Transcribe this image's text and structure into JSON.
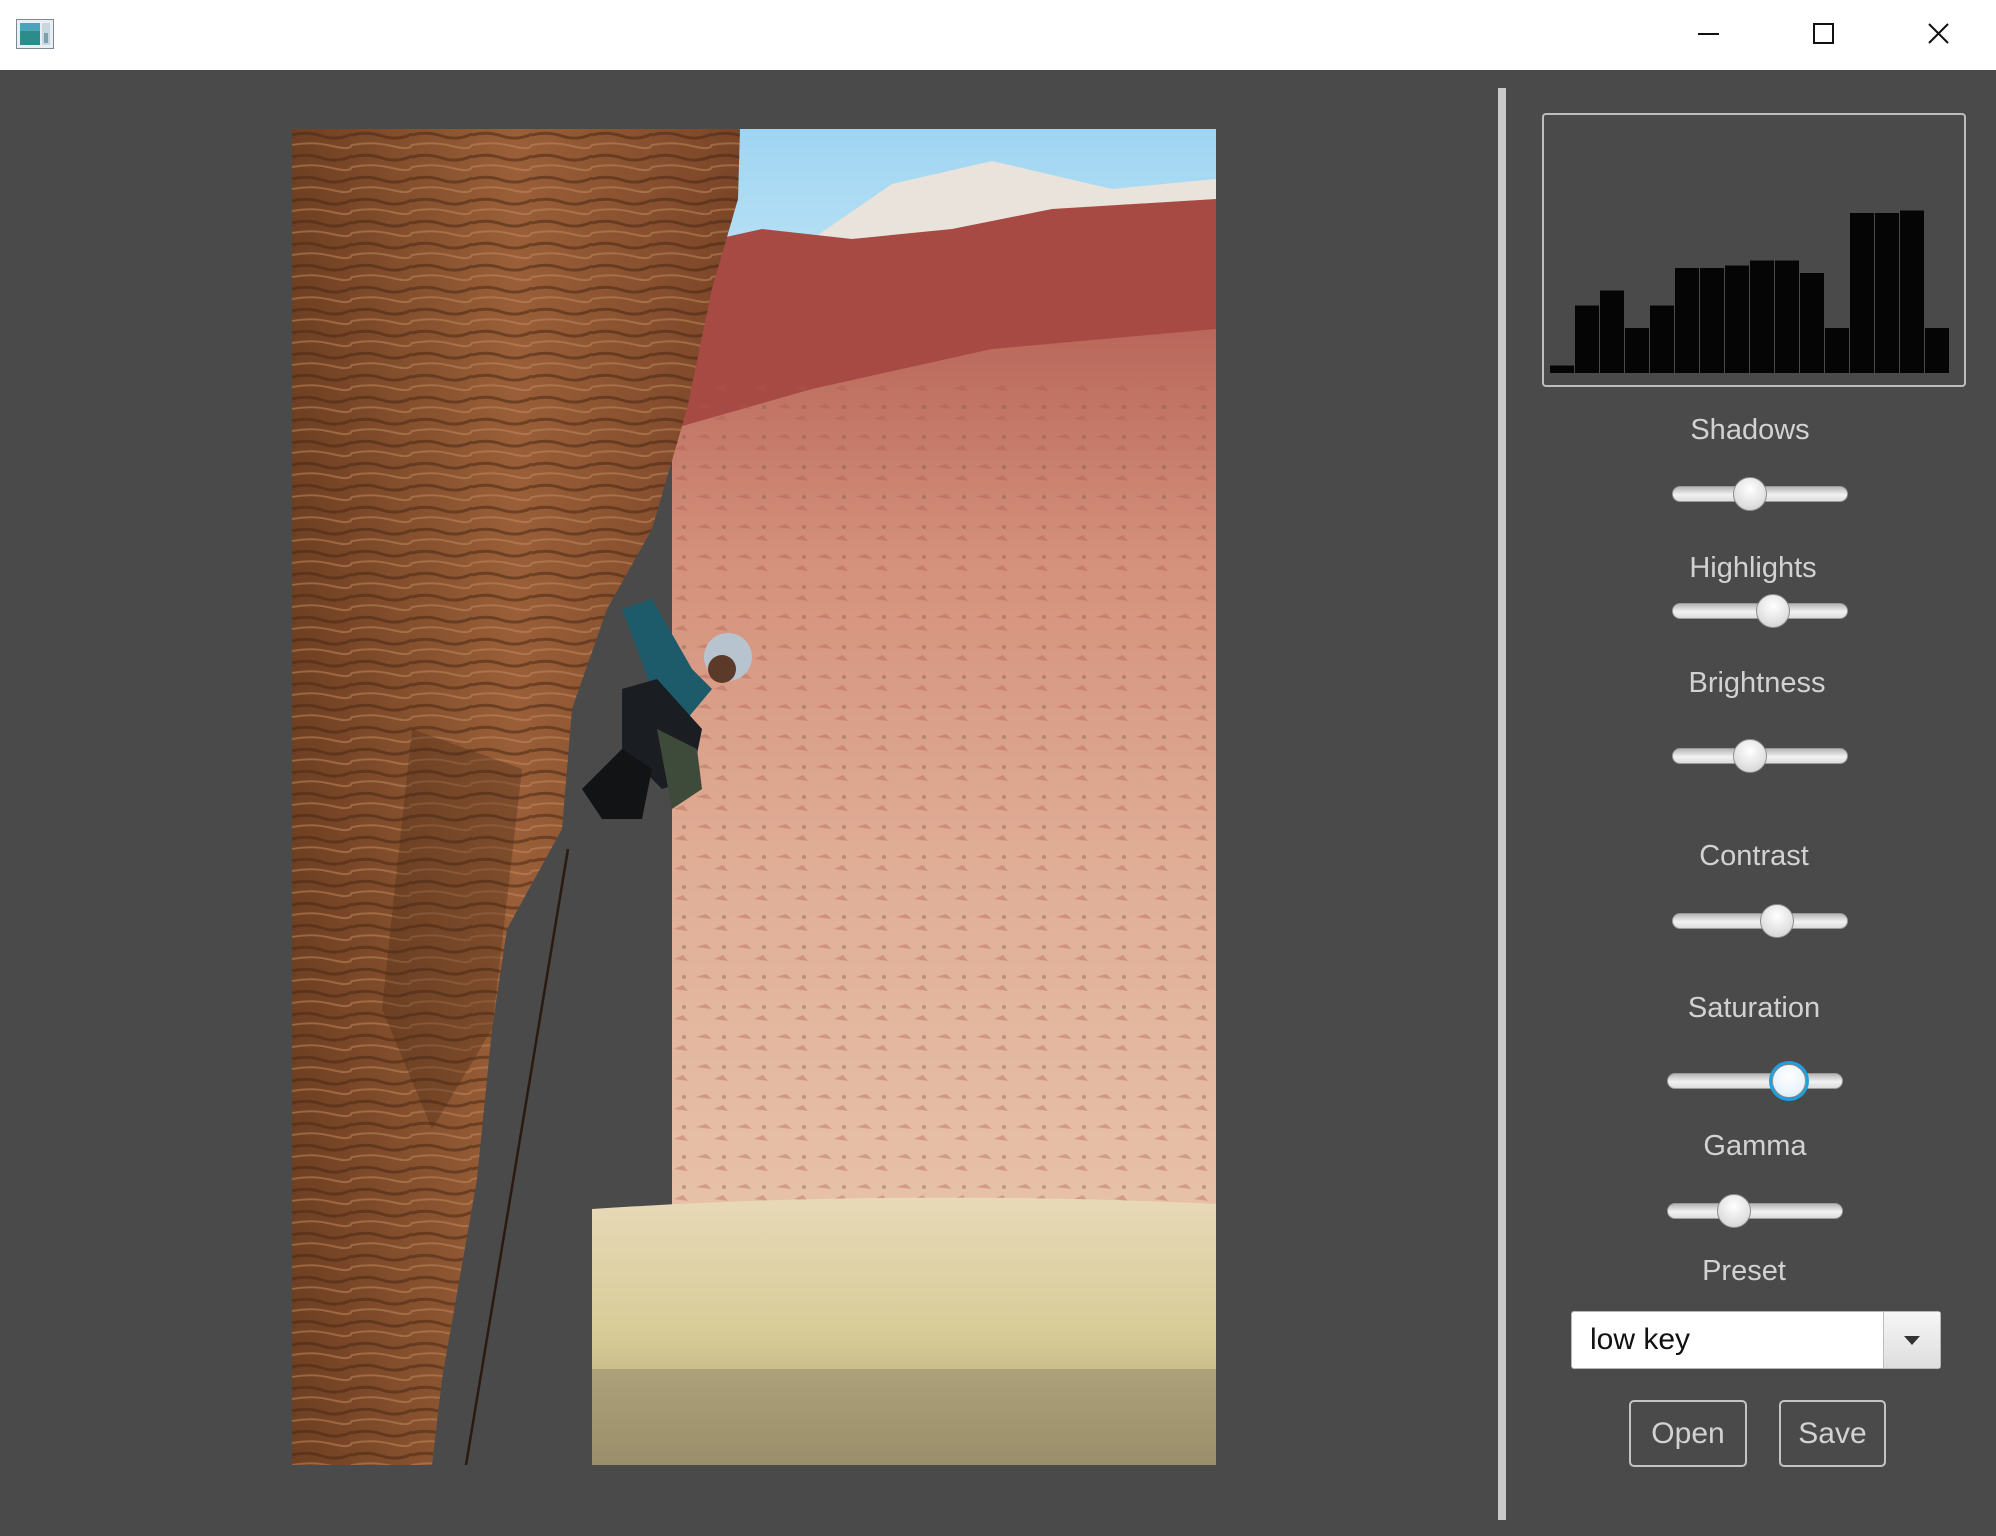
{
  "window": {
    "icon": "app-image-icon",
    "controls": [
      "minimize-icon",
      "maximize-icon",
      "close-icon"
    ]
  },
  "image": {
    "description_icon": "photo-rock-climber"
  },
  "histogram": {
    "bins": [
      0.03,
      0.27,
      0.33,
      0.18,
      0.27,
      0.42,
      0.42,
      0.43,
      0.45,
      0.45,
      0.4,
      0.18,
      0.64,
      0.64,
      0.65,
      0.18
    ]
  },
  "controls": {
    "shadows": {
      "label": "Shadows",
      "value": 0.43
    },
    "highlights": {
      "label": "Highlights",
      "value": 0.59
    },
    "brightness": {
      "label": "Brightness",
      "value": 0.43
    },
    "contrast": {
      "label": "Contrast",
      "value": 0.62
    },
    "saturation": {
      "label": "Saturation",
      "value": 0.74
    },
    "gamma": {
      "label": "Gamma",
      "value": 0.35
    },
    "preset": {
      "label": "Preset",
      "value": "low key"
    }
  },
  "buttons": {
    "open": "Open",
    "save": "Save"
  },
  "colors": {
    "background": "#4a4a4a",
    "accent_focus": "#1e9fe0",
    "label_text": "#d2d2d2"
  }
}
